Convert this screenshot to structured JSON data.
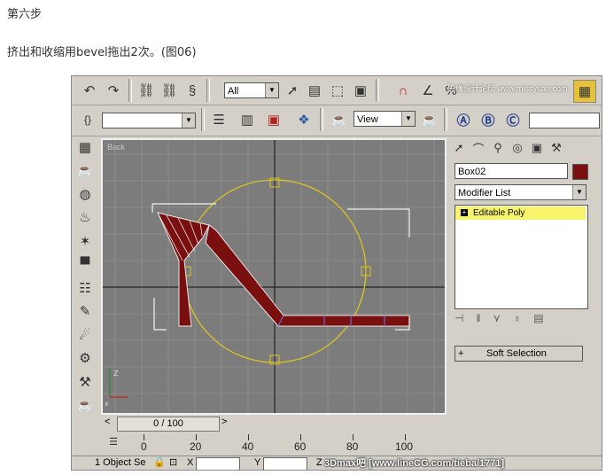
{
  "article": {
    "step_title": "第六步",
    "description": "挤出和收缩用bevel拖出2次。(图06)"
  },
  "toolbar_main": {
    "selection_filter": "All",
    "watermark_top": "思缘设计论坛 www.missyuan.com"
  },
  "toolbar_second": {
    "named_selection": "",
    "ref_coord": "View"
  },
  "viewport": {
    "label": "Back"
  },
  "command_panel": {
    "object_name": "Box02",
    "object_color": "#7a1010",
    "modifier_list_label": "Modifier List",
    "stack_items": [
      "Editable Poly"
    ],
    "rollout_plus": "+",
    "rollout_label": "Soft Selection"
  },
  "timeline": {
    "slider_label": "0 / 100",
    "prev": "<",
    "next": ">",
    "ruler_labels": [
      "0",
      "20",
      "40",
      "60",
      "80",
      "100"
    ]
  },
  "status_bar": {
    "selection_info": "1 Object Se",
    "x_label": "X",
    "y_label": "Y",
    "z_label": "Z",
    "watermark": "3Dmax吧 [www.lineCG.com/tieba/1771]"
  }
}
